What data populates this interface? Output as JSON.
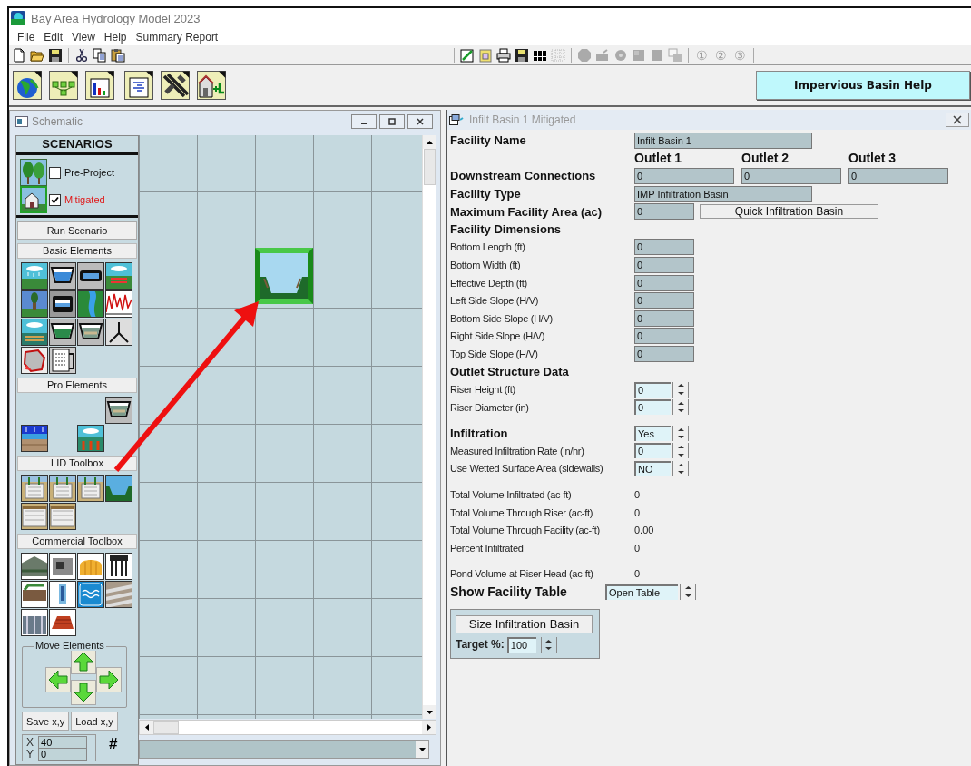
{
  "window": {
    "title": "Bay Area Hydrology Model 2023"
  },
  "menu": [
    "File",
    "Edit",
    "View",
    "Help",
    "Summary Report"
  ],
  "toolbar": {
    "left": [
      {
        "disabled": false
      },
      {
        "disabled": false
      },
      {
        "disabled": false
      },
      {
        "disabled": false
      },
      {
        "disabled": false
      },
      {
        "disabled": false
      }
    ],
    "right": [
      {
        "disabled": false
      },
      {
        "disabled": false
      },
      {
        "disabled": false
      },
      {
        "disabled": false
      },
      {
        "disabled": false
      },
      {
        "disabled": true
      },
      {
        "disabled": true
      },
      {
        "disabled": true
      },
      {
        "disabled": true
      },
      {
        "disabled": true
      },
      {
        "disabled": true
      },
      {
        "disabled": true
      }
    ],
    "steps": [
      {
        "label": "①",
        "disabled": true
      },
      {
        "label": "②",
        "disabled": true
      },
      {
        "label": "③",
        "disabled": true
      }
    ]
  },
  "help_button": "Impervious Basin Help",
  "schematic": {
    "title": "Schematic",
    "scenarios_title": "SCENARIOS",
    "scenarios": [
      {
        "label": "Pre-Project",
        "checked": false
      },
      {
        "label": "Mitigated",
        "checked": true
      }
    ],
    "run_button": "Run Scenario",
    "palette": [
      {
        "title": "Basic Elements"
      },
      {
        "title": "Pro Elements"
      },
      {
        "title": "LID Toolbox"
      },
      {
        "title": "Commercial Toolbox"
      }
    ],
    "move_title": "Move Elements",
    "save_button": "Save x,y",
    "load_button": "Load x,y",
    "coords": [
      {
        "label": "X",
        "value": "40"
      },
      {
        "label": "Y",
        "value": "0"
      }
    ],
    "grid_button": "#"
  },
  "facility": {
    "title": "Infilt Basin  1 Mitigated",
    "sections": [
      {
        "rows": [
          {
            "kind": "text_field",
            "label": "Facility Name",
            "values": [
              "Infilt Basin  1"
            ]
          },
          {
            "kind": "column_heads",
            "values": [
              "Outlet 1",
              "Outlet 2",
              "Outlet 3"
            ]
          },
          {
            "kind": "multi_field",
            "label": "Downstream Connections",
            "values": [
              "0",
              "0",
              "0"
            ]
          },
          {
            "kind": "text_field",
            "label": "Facility Type",
            "values": [
              "IMP Infiltration Basin"
            ]
          },
          {
            "kind": "field_button",
            "label": "Maximum Facility Area (ac)",
            "values": [
              "0"
            ],
            "button": "Quick Infiltration Basin"
          },
          {
            "kind": "heading",
            "label": "Facility Dimensions"
          },
          {
            "kind": "field",
            "label": "Bottom Length (ft)",
            "values": [
              "0"
            ]
          },
          {
            "kind": "field",
            "label": "Bottom Width (ft)",
            "values": [
              "0"
            ]
          },
          {
            "kind": "field",
            "label": "Effective Depth (ft)",
            "values": [
              "0"
            ]
          },
          {
            "kind": "field",
            "label": "Left Side Slope (H/V)",
            "values": [
              "0"
            ]
          },
          {
            "kind": "field",
            "label": "Bottom Side Slope (H/V)",
            "values": [
              "0"
            ]
          },
          {
            "kind": "field",
            "label": "Right Side Slope (H/V)",
            "values": [
              "0"
            ]
          },
          {
            "kind": "field",
            "label": "Top Side Slope (H/V)",
            "values": [
              "0"
            ]
          },
          {
            "kind": "heading",
            "label": "Outlet Structure Data"
          },
          {
            "kind": "spin",
            "label": "Riser Height (ft)",
            "values": [
              "0"
            ]
          },
          {
            "kind": "spin",
            "label": "Riser Diameter (in)",
            "values": [
              "0"
            ]
          }
        ]
      },
      {
        "rows": [
          {
            "kind": "bold_spin",
            "label": "Infiltration",
            "values": [
              "Yes"
            ]
          },
          {
            "kind": "spin",
            "label": "Measured Infiltration Rate (in/hr)",
            "values": [
              "0"
            ]
          },
          {
            "kind": "spin",
            "label": "Use Wetted Surface Area (sidewalls)",
            "values": [
              "NO"
            ]
          }
        ]
      },
      {
        "rows": [
          {
            "kind": "readout",
            "label": "Total Volume Infiltrated (ac-ft)",
            "values": [
              "0"
            ]
          },
          {
            "kind": "readout",
            "label": "Total Volume Through Riser (ac-ft)",
            "values": [
              "0"
            ]
          },
          {
            "kind": "readout",
            "label": "Total Volume Through Facility (ac-ft)",
            "values": [
              "0.00"
            ]
          },
          {
            "kind": "readout",
            "label": "Percent Infiltrated",
            "values": [
              "0"
            ]
          }
        ]
      },
      {
        "rows": [
          {
            "kind": "readout",
            "label": "Pond Volume at Riser Head (ac-ft)",
            "values": [
              "0"
            ]
          },
          {
            "kind": "table_spin",
            "label": "Show Facility Table",
            "values": [
              "Open Table"
            ]
          }
        ]
      }
    ],
    "sizing": {
      "button": "Size Infiltration Basin",
      "target_label": "Target %:",
      "target_value": "100"
    }
  }
}
